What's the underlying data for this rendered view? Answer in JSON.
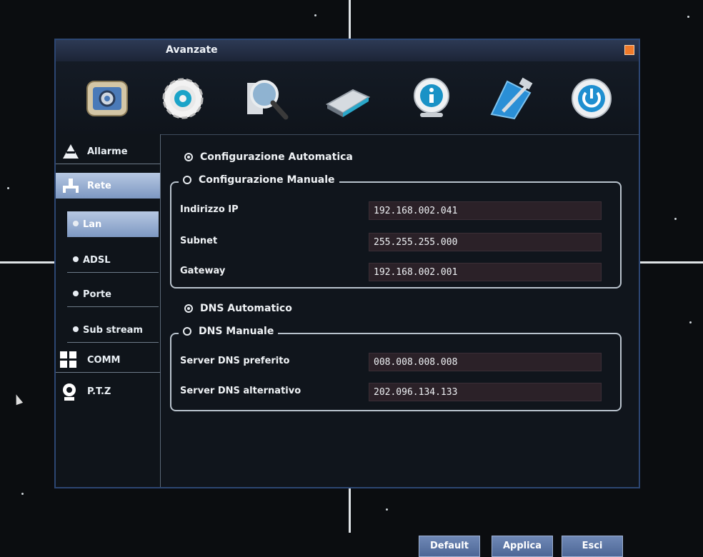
{
  "window": {
    "title": "Avanzate"
  },
  "toolbar": {
    "icons": [
      "settings-panel-icon",
      "gear-icon",
      "search-icon",
      "hard-disk-icon",
      "info-icon",
      "tools-icon",
      "power-icon"
    ]
  },
  "sidebar": {
    "items": [
      {
        "label": "Allarme"
      },
      {
        "label": "Rete"
      },
      {
        "label": "Lan"
      },
      {
        "label": "ADSL"
      },
      {
        "label": "Porte"
      },
      {
        "label": "Sub stream"
      },
      {
        "label": "COMM"
      },
      {
        "label": "P.T.Z"
      }
    ]
  },
  "network": {
    "auto_config_label": "Configurazione Automatica",
    "manual_config_label": "Configurazione Manuale",
    "ip_label": "Indirizzo IP",
    "ip_value": "192.168.002.041",
    "subnet_label": "Subnet",
    "subnet_value": "255.255.255.000",
    "gateway_label": "Gateway",
    "gateway_value": "192.168.002.001",
    "dns_auto_label": "DNS Automatico",
    "dns_manual_label": "DNS Manuale",
    "dns_pref_label": "Server DNS preferito",
    "dns_pref_value": "008.008.008.008",
    "dns_alt_label": "Server DNS alternativo",
    "dns_alt_value": "202.096.134.133"
  },
  "buttons": {
    "default": "Default",
    "apply": "Applica",
    "exit": "Esci"
  },
  "colors": {
    "accent": "#5a74a4",
    "active_item": "#9fb4d6",
    "field_bg": "#2b2128"
  }
}
